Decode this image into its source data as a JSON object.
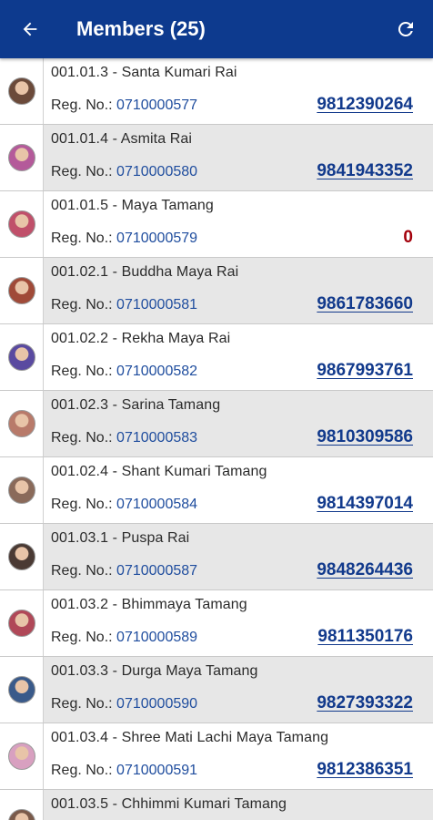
{
  "appbar": {
    "title": "Members (25)",
    "back_icon": "arrow-left-icon",
    "refresh_icon": "refresh-icon",
    "color": "#0d3a8e"
  },
  "reg_label": "Reg. No.:",
  "members": [
    {
      "code_name": "001.01.3 - Santa Kumari Rai",
      "reg_no": "0710000577",
      "phone": "9812390264",
      "avatar_color": "#6b4a3a"
    },
    {
      "code_name": "001.01.4 - Asmita Rai",
      "reg_no": "0710000580",
      "phone": "9841943352",
      "avatar_color": "#b45a9a"
    },
    {
      "code_name": "001.01.5 - Maya Tamang",
      "reg_no": "0710000579",
      "phone": "0",
      "avatar_color": "#c0506a"
    },
    {
      "code_name": "001.02.1 - Buddha Maya Rai",
      "reg_no": "0710000581",
      "phone": "9861783660",
      "avatar_color": "#a04a38"
    },
    {
      "code_name": "001.02.2 - Rekha Maya Rai",
      "reg_no": "0710000582",
      "phone": "9867993761",
      "avatar_color": "#5a4aa0"
    },
    {
      "code_name": "001.02.3 - Sarina Tamang",
      "reg_no": "0710000583",
      "phone": "9810309586",
      "avatar_color": "#b87a6a"
    },
    {
      "code_name": "001.02.4 - Shant Kumari Tamang",
      "reg_no": "0710000584",
      "phone": "9814397014",
      "avatar_color": "#8a6a5a"
    },
    {
      "code_name": "001.03.1 - Puspa Rai",
      "reg_no": "0710000587",
      "phone": "9848264436",
      "avatar_color": "#4a3a34"
    },
    {
      "code_name": "001.03.2 - Bhimmaya Tamang",
      "reg_no": "0710000589",
      "phone": "9811350176",
      "avatar_color": "#b04858"
    },
    {
      "code_name": "001.03.3 - Durga Maya Tamang",
      "reg_no": "0710000590",
      "phone": "9827393322",
      "avatar_color": "#3a5a8a"
    },
    {
      "code_name": "001.03.4 - Shree Mati Lachi Maya Tamang",
      "reg_no": "0710000591",
      "phone": "9812386351",
      "avatar_color": "#d8a0c0"
    },
    {
      "code_name": "001.03.5 - Chhimmi Kumari Tamang",
      "reg_no": "",
      "phone": "",
      "avatar_color": "#7a5a4a"
    }
  ]
}
